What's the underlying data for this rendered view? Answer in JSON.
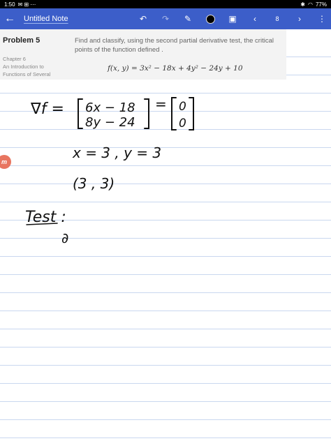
{
  "status_bar": {
    "time": "1:50",
    "battery": "77%"
  },
  "toolbar": {
    "title": "Untitled Note",
    "page_number": "8",
    "icons": [
      "back-arrow-icon",
      "undo-icon",
      "redo-icon",
      "pen-icon",
      "color-dot-icon",
      "image-icon",
      "prev-page-icon",
      "next-page-icon",
      "more-icon"
    ]
  },
  "problem": {
    "title": "Problem 5",
    "chapter": "Chapter 6",
    "section_line1": "An Introduction to",
    "section_line2": "Functions of Several",
    "text": "Find and classify, using the second partial derivative test, the critical points of the function defined .",
    "formula": "f(x, y) = 3x² − 18x + 4y² − 24y + 10"
  },
  "handwriting": {
    "grad": "∇f =",
    "row1": "6x − 18",
    "row2": "8y − 24",
    "eq": "=",
    "zero1": "0",
    "zero2": "0",
    "solution": "x = 3 ,  y = 3",
    "point": "(3 , 3)",
    "test": "Test :",
    "partial": "∂"
  },
  "badge": {
    "letter": "m"
  }
}
